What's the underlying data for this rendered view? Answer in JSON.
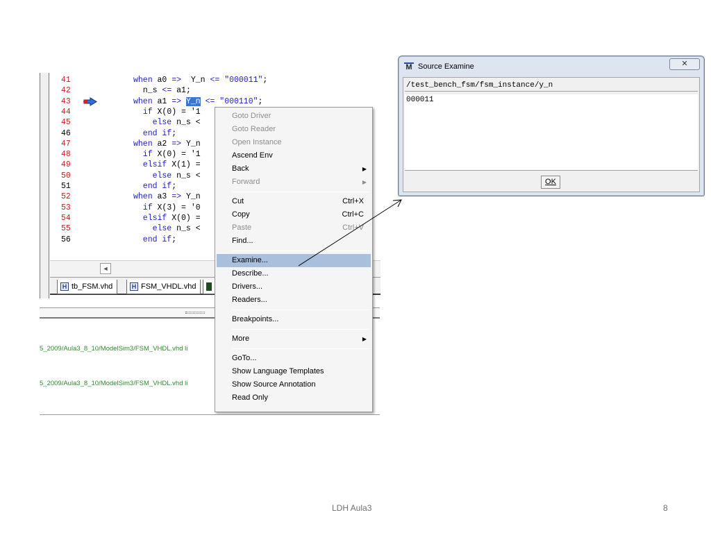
{
  "code_lines": [
    {
      "num": "41",
      "num_color": "red",
      "segments": [
        {
          "t": "when ",
          "c": "kw"
        },
        {
          "t": "a0 "
        },
        {
          "t": "=> ",
          "c": "kw"
        },
        {
          "t": " Y_n "
        },
        {
          "t": "<= ",
          "c": "kw"
        },
        {
          "t": "\"000011\"",
          "c": "str"
        },
        {
          "t": ";"
        }
      ]
    },
    {
      "num": "42",
      "num_color": "red",
      "segments": [
        {
          "t": "  n_s "
        },
        {
          "t": "<= ",
          "c": "kw"
        },
        {
          "t": "a1;"
        }
      ]
    },
    {
      "num": "43",
      "num_color": "red",
      "breakpoint": true,
      "segments": [
        {
          "t": "when ",
          "c": "kw"
        },
        {
          "t": "a1 "
        },
        {
          "t": "=> ",
          "c": "kw"
        },
        {
          "t": "Y_n",
          "c": "hl"
        },
        {
          "t": " "
        },
        {
          "t": "<= ",
          "c": "kw"
        },
        {
          "t": "\"000110\"",
          "c": "str"
        },
        {
          "t": ";"
        }
      ]
    },
    {
      "num": "44",
      "num_color": "red",
      "segments": [
        {
          "t": "  if ",
          "c": "kw"
        },
        {
          "t": "X(0) = '1"
        }
      ]
    },
    {
      "num": "45",
      "num_color": "red",
      "segments": [
        {
          "t": "    else ",
          "c": "kw"
        },
        {
          "t": "n_s <"
        }
      ]
    },
    {
      "num": "46",
      "num_color": "plain",
      "segments": [
        {
          "t": "  end if",
          "c": "kw"
        },
        {
          "t": ";"
        }
      ]
    },
    {
      "num": "47",
      "num_color": "red",
      "segments": [
        {
          "t": "when ",
          "c": "kw"
        },
        {
          "t": "a2 "
        },
        {
          "t": "=> ",
          "c": "kw"
        },
        {
          "t": "Y_n"
        }
      ]
    },
    {
      "num": "48",
      "num_color": "red",
      "segments": [
        {
          "t": "  if ",
          "c": "kw"
        },
        {
          "t": "X(0) = '1"
        }
      ]
    },
    {
      "num": "49",
      "num_color": "red",
      "segments": [
        {
          "t": "  elsif ",
          "c": "kw"
        },
        {
          "t": "X(1) ="
        }
      ]
    },
    {
      "num": "50",
      "num_color": "red",
      "segments": [
        {
          "t": "    else ",
          "c": "kw"
        },
        {
          "t": "n_s <"
        }
      ]
    },
    {
      "num": "51",
      "num_color": "plain",
      "segments": [
        {
          "t": "  end if",
          "c": "kw"
        },
        {
          "t": ";"
        }
      ]
    },
    {
      "num": "52",
      "num_color": "red",
      "segments": [
        {
          "t": "when ",
          "c": "kw"
        },
        {
          "t": "a3 "
        },
        {
          "t": "=> ",
          "c": "kw"
        },
        {
          "t": "Y_n"
        }
      ]
    },
    {
      "num": "53",
      "num_color": "red",
      "segments": [
        {
          "t": "  if ",
          "c": "kw"
        },
        {
          "t": "X(3) = '0"
        }
      ]
    },
    {
      "num": "54",
      "num_color": "red",
      "segments": [
        {
          "t": "  elsif ",
          "c": "kw"
        },
        {
          "t": "X(0) ="
        }
      ]
    },
    {
      "num": "55",
      "num_color": "red",
      "segments": [
        {
          "t": "    else ",
          "c": "kw"
        },
        {
          "t": "n_s <"
        }
      ]
    },
    {
      "num": "56",
      "num_color": "plain",
      "segments": [
        {
          "t": "  end if",
          "c": "kw"
        },
        {
          "t": ";"
        }
      ]
    }
  ],
  "scroll_left_glyph": "◄",
  "tabs": [
    {
      "icon": "H",
      "label": "tb_FSM.vhd"
    },
    {
      "icon": "H",
      "label": "FSM_VHDL.vhd"
    },
    {
      "icon": "",
      "label": ""
    }
  ],
  "transcript": [
    "5_2009/Aula3_8_10/ModelSim3/FSM_VHDL.vhd li",
    "5_2009/Aula3_8_10/ModelSim3/FSM_VHDL.vhd li"
  ],
  "context_menu": [
    {
      "label": "Goto Driver",
      "disabled": true
    },
    {
      "label": "Goto Reader",
      "disabled": true
    },
    {
      "label": "Open Instance",
      "disabled": true
    },
    {
      "label": "Ascend Env"
    },
    {
      "label": "Back",
      "submenu": true
    },
    {
      "label": "Forward",
      "disabled": true,
      "submenu": true
    },
    {
      "sep": true
    },
    {
      "label": "Cut",
      "shortcut": "Ctrl+X"
    },
    {
      "label": "Copy",
      "shortcut": "Ctrl+C"
    },
    {
      "label": "Paste",
      "shortcut": "Ctrl+V",
      "disabled": true
    },
    {
      "label": "Find..."
    },
    {
      "sep": true
    },
    {
      "label": "Examine...",
      "selected": true
    },
    {
      "label": "Describe..."
    },
    {
      "label": "Drivers..."
    },
    {
      "label": "Readers..."
    },
    {
      "sep": true
    },
    {
      "label": "Breakpoints..."
    },
    {
      "sep": true
    },
    {
      "label": "More",
      "submenu": true
    },
    {
      "sep": true
    },
    {
      "label": "GoTo..."
    },
    {
      "label": "Show Language Templates"
    },
    {
      "label": "Show Source Annotation"
    },
    {
      "label": "Read Only"
    }
  ],
  "dialog": {
    "title": "Source Examine",
    "logo": "M",
    "close_glyph": "✕",
    "signal_path": "/test_bench_fsm/fsm_instance/y_n",
    "value": "000011",
    "ok_label": "OK"
  },
  "footer": {
    "center": "LDH Aula3",
    "page": "8"
  }
}
